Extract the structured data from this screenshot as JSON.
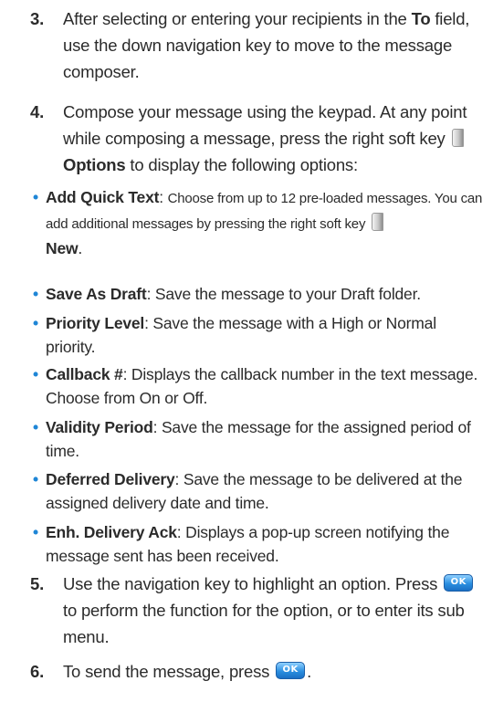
{
  "step3": {
    "num": "3.",
    "pre": "After selecting or entering your recipients in the ",
    "bold": "To",
    "post": " field, use the down navigation key to move to the message composer."
  },
  "step4": {
    "num": "4.",
    "pre": "Compose your message using the keypad. At any point while composing a message, press the right soft key ",
    "bold": "Options",
    "post": " to display the following options:"
  },
  "options": [
    {
      "title": "Add Quick Text",
      "desc_a": "Choose from up to 12 pre-loaded messages. You can add additional messages by pressing the right soft key",
      "desc_b": "New",
      "desc_c": "."
    },
    {
      "title": "Save As Draft",
      "desc": "Save the message to your Draft folder."
    },
    {
      "title": "Priority Level",
      "desc": "Save the message with a High or Normal priority."
    },
    {
      "title": "Callback #",
      "desc": "Displays the callback number in the text message. Choose from On or Off."
    },
    {
      "title": "Validity Period",
      "desc": "Save the message for the assigned period of time."
    },
    {
      "title": "Deferred Delivery",
      "desc": "Save the message to be delivered at the assigned delivery date and time."
    },
    {
      "title": "Enh. Delivery Ack",
      "desc": "Displays a pop-up screen notifying the message sent has been received."
    }
  ],
  "bullet_glyph": "•",
  "sep": ": ",
  "step5": {
    "num": "5.",
    "pre": "Use the navigation key to highlight an option. Press",
    "post": "to perform the function for the option, or to enter its sub menu."
  },
  "step6": {
    "num": "6.",
    "pre": "To send the message, press",
    "post": "."
  },
  "ok_key_label": "OK",
  "colors": {
    "bullet": "#1f86d6",
    "ok_key": "#2b8fe0",
    "text": "#2b2b2b"
  },
  "icons": {
    "right_soft_key": "right-soft-key-icon",
    "ok_key": "ok-key-icon"
  }
}
